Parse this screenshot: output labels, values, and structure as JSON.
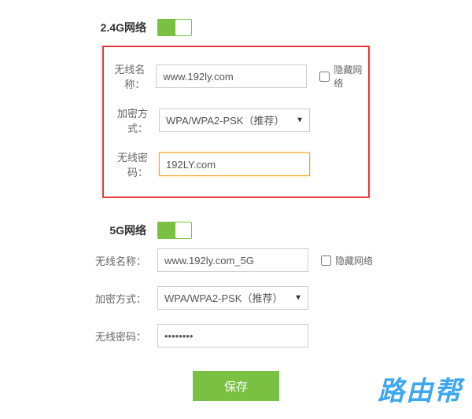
{
  "network24": {
    "title": "2.4G网络",
    "toggle_on": true,
    "ssid_label": "无线名称：",
    "ssid_value": "www.192ly.com",
    "hide_label": "隐藏网络",
    "hide_checked": false,
    "encryption_label": "加密方式：",
    "encryption_value": "WPA/WPA2-PSK（推荐）",
    "password_label": "无线密码：",
    "password_value": "192LY.com"
  },
  "network5g": {
    "title": "5G网络",
    "toggle_on": true,
    "ssid_label": "无线名称：",
    "ssid_value": "www.192ly.com_5G",
    "hide_label": "隐藏网络",
    "hide_checked": false,
    "encryption_label": "加密方式：",
    "encryption_value": "WPA/WPA2-PSK（推荐）",
    "password_label": "无线密码：",
    "password_value": "••••••••"
  },
  "save_label": "保存",
  "watermark": "路由帮"
}
